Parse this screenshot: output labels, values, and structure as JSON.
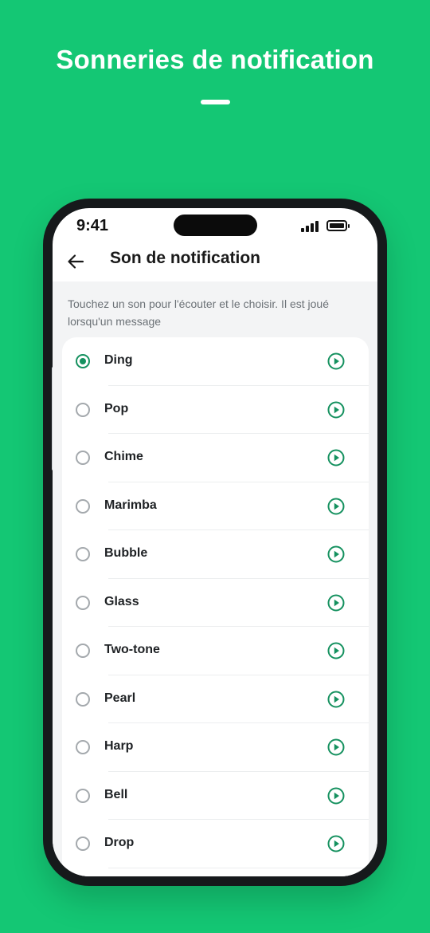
{
  "headline": "Sonneries de notification",
  "status": {
    "time": "9:41"
  },
  "appbar": {
    "title": "Son de notification"
  },
  "helper_text": "Touchez un son pour l'écouter et le choisir. Il est joué lorsqu'un message",
  "colors": {
    "background": "#14c774",
    "accent": "#15915f"
  },
  "sounds": [
    {
      "label": "Ding",
      "selected": true
    },
    {
      "label": "Pop",
      "selected": false
    },
    {
      "label": "Chime",
      "selected": false
    },
    {
      "label": "Marimba",
      "selected": false
    },
    {
      "label": "Bubble",
      "selected": false
    },
    {
      "label": "Glass",
      "selected": false
    },
    {
      "label": "Two-tone",
      "selected": false
    },
    {
      "label": "Pearl",
      "selected": false
    },
    {
      "label": "Harp",
      "selected": false
    },
    {
      "label": "Bell",
      "selected": false
    },
    {
      "label": "Drop",
      "selected": false
    }
  ]
}
